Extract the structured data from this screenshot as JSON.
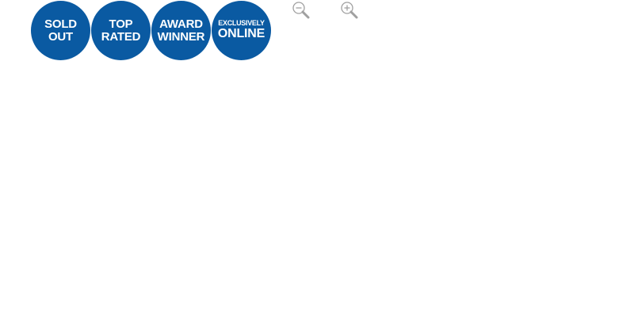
{
  "badges": {
    "sold_out": {
      "line1": "SOLD",
      "line2": "OUT"
    },
    "top_rated": {
      "line1": "TOP",
      "line2": "RATED"
    },
    "award_winner": {
      "line1": "AWARD",
      "line2": "WINNER"
    },
    "exclusively_online": {
      "line1": "EXCLUSIVELY",
      "line2": "ONLINE"
    }
  },
  "zoom_controls": {
    "zoom_out_icon": "zoom-out-icon",
    "zoom_in_icon": "zoom-in-icon"
  },
  "colors": {
    "badge_background": "#0a5aa2",
    "badge_text": "#ffffff",
    "icon_gray": "#a0a0a0"
  }
}
